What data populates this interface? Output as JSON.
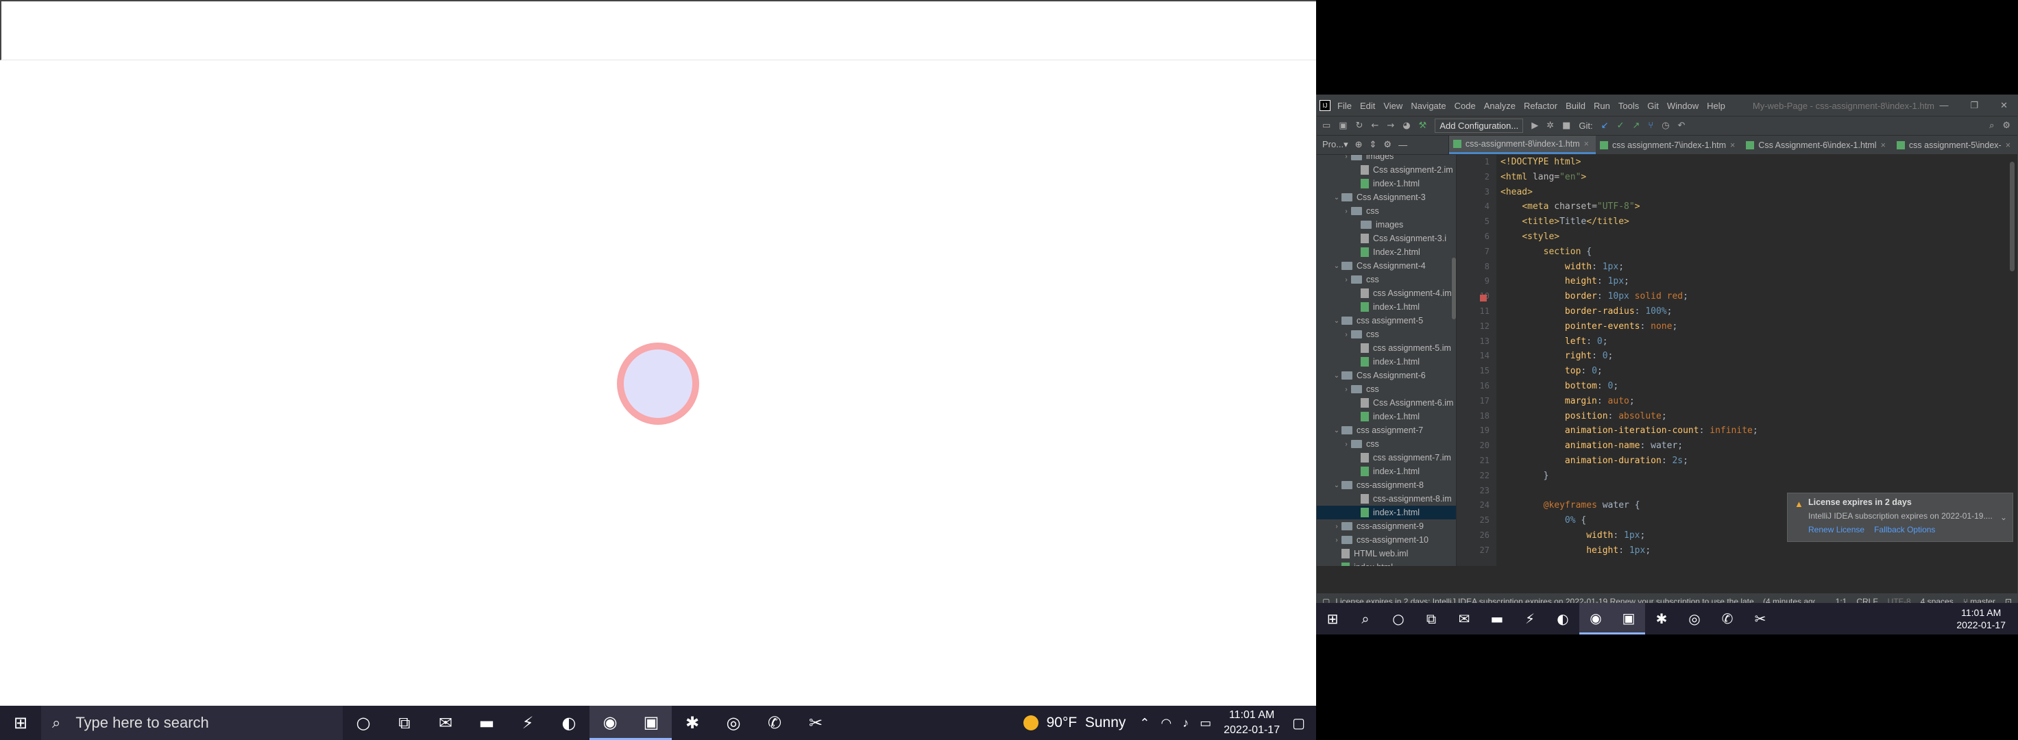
{
  "left": {
    "taskbar": {
      "start": "⊞",
      "search_placeholder": "Type here to search",
      "search_icon": "search-icon",
      "apps": [
        {
          "name": "cortana-icon",
          "glyph": "○",
          "active": false
        },
        {
          "name": "task-view-icon",
          "glyph": "⧉",
          "active": false
        },
        {
          "name": "mail-icon",
          "glyph": "✉",
          "active": false
        },
        {
          "name": "file-explorer-icon",
          "glyph": "▬",
          "active": false
        },
        {
          "name": "bolt-app-icon",
          "glyph": "⚡",
          "active": false
        },
        {
          "name": "edge-icon",
          "glyph": "◐",
          "active": false
        },
        {
          "name": "chrome-icon",
          "glyph": "◉",
          "active": true
        },
        {
          "name": "intellij-icon",
          "glyph": "▣",
          "active": true
        },
        {
          "name": "slack-icon",
          "glyph": "✱",
          "active": false
        },
        {
          "name": "recorder-icon",
          "glyph": "◎",
          "active": false
        },
        {
          "name": "whatsapp-icon",
          "glyph": "✆",
          "active": false
        },
        {
          "name": "snipping-icon",
          "glyph": "✂",
          "active": false
        }
      ],
      "weather": {
        "temp": "90°F",
        "cond": "Sunny"
      },
      "tray_glyphs": {
        "chevron": "⌃",
        "wifi": "◠",
        "volume": "♪",
        "battery": "▭"
      },
      "time": "11:01 AM",
      "date": "2022-01-17",
      "notifications_glyph": "▢"
    }
  },
  "ide": {
    "menu": [
      "File",
      "Edit",
      "View",
      "Navigate",
      "Code",
      "Analyze",
      "Refactor",
      "Build",
      "Run",
      "Tools",
      "Git",
      "Window",
      "Help"
    ],
    "window_title": "My-web-Page - css-assignment-8\\index-1.htm",
    "window_controls": {
      "minimize": "—",
      "restore": "❐",
      "close": "✕"
    },
    "toolbar": {
      "add_config": "Add Configuration...",
      "git_label": "Git:"
    },
    "project_label": "Pro...▾",
    "tabs": [
      {
        "label": "css-assignment-8\\index-1.htm",
        "active": true
      },
      {
        "label": "css assignment-7\\index-1.htm",
        "active": false
      },
      {
        "label": "Css Assignment-6\\index-1.html",
        "active": false
      },
      {
        "label": "css assignment-5\\index-",
        "active": false
      }
    ],
    "tree": [
      {
        "indent": 2,
        "type": "folder",
        "arrow": "›",
        "label": "images"
      },
      {
        "indent": 3,
        "type": "iml",
        "arrow": "",
        "label": "Css assignment-2.im"
      },
      {
        "indent": 3,
        "type": "file",
        "arrow": "",
        "label": "index-1.html"
      },
      {
        "indent": 1,
        "type": "folder",
        "arrow": "⌄",
        "label": "Css Assignment-3"
      },
      {
        "indent": 2,
        "type": "folder",
        "arrow": "›",
        "label": "css"
      },
      {
        "indent": 3,
        "type": "folder",
        "arrow": "",
        "label": "images"
      },
      {
        "indent": 3,
        "type": "iml",
        "arrow": "",
        "label": "Css Assignment-3.i"
      },
      {
        "indent": 3,
        "type": "file",
        "arrow": "",
        "label": "Index-2.html"
      },
      {
        "indent": 1,
        "type": "folder",
        "arrow": "⌄",
        "label": "Css Assignment-4"
      },
      {
        "indent": 2,
        "type": "folder",
        "arrow": "›",
        "label": "css"
      },
      {
        "indent": 3,
        "type": "iml",
        "arrow": "",
        "label": "css Assignment-4.im"
      },
      {
        "indent": 3,
        "type": "file",
        "arrow": "",
        "label": "index-1.html"
      },
      {
        "indent": 1,
        "type": "folder",
        "arrow": "⌄",
        "label": "css assignment-5"
      },
      {
        "indent": 2,
        "type": "folder",
        "arrow": "›",
        "label": "css"
      },
      {
        "indent": 3,
        "type": "iml",
        "arrow": "",
        "label": "css assignment-5.im"
      },
      {
        "indent": 3,
        "type": "file",
        "arrow": "",
        "label": "index-1.html"
      },
      {
        "indent": 1,
        "type": "folder",
        "arrow": "⌄",
        "label": "Css Assignment-6"
      },
      {
        "indent": 2,
        "type": "folder",
        "arrow": "›",
        "label": "css"
      },
      {
        "indent": 3,
        "type": "iml",
        "arrow": "",
        "label": "Css Assignment-6.im"
      },
      {
        "indent": 3,
        "type": "file",
        "arrow": "",
        "label": "index-1.html"
      },
      {
        "indent": 1,
        "type": "folder",
        "arrow": "⌄",
        "label": "css assignment-7"
      },
      {
        "indent": 2,
        "type": "folder",
        "arrow": "›",
        "label": "css"
      },
      {
        "indent": 3,
        "type": "iml",
        "arrow": "",
        "label": "css assignment-7.im"
      },
      {
        "indent": 3,
        "type": "file",
        "arrow": "",
        "label": "index-1.html"
      },
      {
        "indent": 1,
        "type": "folder",
        "arrow": "⌄",
        "label": "css-assignment-8"
      },
      {
        "indent": 3,
        "type": "iml",
        "arrow": "",
        "label": "css-assignment-8.im"
      },
      {
        "indent": 3,
        "type": "file",
        "arrow": "",
        "label": "index-1.html",
        "selected": true
      },
      {
        "indent": 1,
        "type": "folder",
        "arrow": "›",
        "label": "css-assignment-9"
      },
      {
        "indent": 1,
        "type": "folder",
        "arrow": "›",
        "label": "css-assignment-10"
      },
      {
        "indent": 1,
        "type": "iml",
        "arrow": "",
        "label": "HTML web.iml"
      },
      {
        "indent": 1,
        "type": "file",
        "arrow": "",
        "label": "index.html"
      }
    ],
    "code": [
      [
        {
          "c": "tag",
          "t": "<!DOCTYPE html>"
        }
      ],
      [
        {
          "c": "tag",
          "t": "<html "
        },
        {
          "c": "attr",
          "t": "lang="
        },
        {
          "c": "str",
          "t": "\"en\""
        },
        {
          "c": "tag",
          "t": ">"
        }
      ],
      [
        {
          "c": "tag",
          "t": "<head>"
        }
      ],
      [
        {
          "c": "",
          "t": "    "
        },
        {
          "c": "tag",
          "t": "<meta "
        },
        {
          "c": "attr",
          "t": "charset="
        },
        {
          "c": "str",
          "t": "\"UTF-8\""
        },
        {
          "c": "tag",
          "t": ">"
        }
      ],
      [
        {
          "c": "",
          "t": "    "
        },
        {
          "c": "tag",
          "t": "<title>"
        },
        {
          "c": "",
          "t": "Title"
        },
        {
          "c": "tag",
          "t": "</title>"
        }
      ],
      [
        {
          "c": "",
          "t": "    "
        },
        {
          "c": "tag",
          "t": "<style>"
        }
      ],
      [
        {
          "c": "",
          "t": "        "
        },
        {
          "c": "sel",
          "t": "section"
        },
        {
          "c": "",
          "t": " {"
        }
      ],
      [
        {
          "c": "",
          "t": "            "
        },
        {
          "c": "prop",
          "t": "width"
        },
        {
          "c": "",
          "t": ": "
        },
        {
          "c": "num",
          "t": "1px"
        },
        {
          "c": "",
          "t": ";"
        }
      ],
      [
        {
          "c": "",
          "t": "            "
        },
        {
          "c": "prop",
          "t": "height"
        },
        {
          "c": "",
          "t": ": "
        },
        {
          "c": "num",
          "t": "1px"
        },
        {
          "c": "",
          "t": ";"
        }
      ],
      [
        {
          "c": "",
          "t": "            "
        },
        {
          "c": "prop",
          "t": "border"
        },
        {
          "c": "",
          "t": ": "
        },
        {
          "c": "num",
          "t": "10px"
        },
        {
          "c": "kw",
          "t": " solid red"
        },
        {
          "c": "",
          "t": ";"
        }
      ],
      [
        {
          "c": "",
          "t": "            "
        },
        {
          "c": "prop",
          "t": "border-radius"
        },
        {
          "c": "",
          "t": ": "
        },
        {
          "c": "num",
          "t": "100%"
        },
        {
          "c": "",
          "t": ";"
        }
      ],
      [
        {
          "c": "",
          "t": "            "
        },
        {
          "c": "prop",
          "t": "pointer-events"
        },
        {
          "c": "",
          "t": ": "
        },
        {
          "c": "kw",
          "t": "none"
        },
        {
          "c": "",
          "t": ";"
        }
      ],
      [
        {
          "c": "",
          "t": "            "
        },
        {
          "c": "prop",
          "t": "left"
        },
        {
          "c": "",
          "t": ": "
        },
        {
          "c": "num",
          "t": "0"
        },
        {
          "c": "",
          "t": ";"
        }
      ],
      [
        {
          "c": "",
          "t": "            "
        },
        {
          "c": "prop",
          "t": "right"
        },
        {
          "c": "",
          "t": ": "
        },
        {
          "c": "num",
          "t": "0"
        },
        {
          "c": "",
          "t": ";"
        }
      ],
      [
        {
          "c": "",
          "t": "            "
        },
        {
          "c": "prop",
          "t": "top"
        },
        {
          "c": "",
          "t": ": "
        },
        {
          "c": "num",
          "t": "0"
        },
        {
          "c": "",
          "t": ";"
        }
      ],
      [
        {
          "c": "",
          "t": "            "
        },
        {
          "c": "prop",
          "t": "bottom"
        },
        {
          "c": "",
          "t": ": "
        },
        {
          "c": "num",
          "t": "0"
        },
        {
          "c": "",
          "t": ";"
        }
      ],
      [
        {
          "c": "",
          "t": "            "
        },
        {
          "c": "prop",
          "t": "margin"
        },
        {
          "c": "",
          "t": ": "
        },
        {
          "c": "kw",
          "t": "auto"
        },
        {
          "c": "",
          "t": ";"
        }
      ],
      [
        {
          "c": "",
          "t": "            "
        },
        {
          "c": "prop",
          "t": "position"
        },
        {
          "c": "",
          "t": ": "
        },
        {
          "c": "kw",
          "t": "absolute"
        },
        {
          "c": "",
          "t": ";"
        }
      ],
      [
        {
          "c": "",
          "t": "            "
        },
        {
          "c": "prop",
          "t": "animation-iteration-count"
        },
        {
          "c": "",
          "t": ": "
        },
        {
          "c": "kw",
          "t": "infinite"
        },
        {
          "c": "",
          "t": ";"
        }
      ],
      [
        {
          "c": "",
          "t": "            "
        },
        {
          "c": "prop",
          "t": "animation-name"
        },
        {
          "c": "",
          "t": ": "
        },
        {
          "c": "",
          "t": "water"
        },
        {
          "c": "",
          "t": ";"
        }
      ],
      [
        {
          "c": "",
          "t": "            "
        },
        {
          "c": "prop",
          "t": "animation-duration"
        },
        {
          "c": "",
          "t": ": "
        },
        {
          "c": "num",
          "t": "2s"
        },
        {
          "c": "",
          "t": ";"
        }
      ],
      [
        {
          "c": "",
          "t": "        }"
        }
      ],
      [
        {
          "c": "",
          "t": ""
        }
      ],
      [
        {
          "c": "",
          "t": "        "
        },
        {
          "c": "kw",
          "t": "@keyframes"
        },
        {
          "c": "",
          "t": " water {"
        }
      ],
      [
        {
          "c": "",
          "t": "            "
        },
        {
          "c": "num",
          "t": "0%"
        },
        {
          "c": "",
          "t": " {"
        }
      ],
      [
        {
          "c": "",
          "t": "                "
        },
        {
          "c": "prop",
          "t": "width"
        },
        {
          "c": "",
          "t": ": "
        },
        {
          "c": "num",
          "t": "1px"
        },
        {
          "c": "",
          "t": ";"
        }
      ],
      [
        {
          "c": "",
          "t": "                "
        },
        {
          "c": "prop",
          "t": "height"
        },
        {
          "c": "",
          "t": ": "
        },
        {
          "c": "num",
          "t": "1px"
        },
        {
          "c": "",
          "t": ";"
        }
      ]
    ],
    "notification": {
      "title": "License expires in 2 days",
      "body": "IntelliJ IDEA subscription expires on 2022-01-19....",
      "link1": "Renew License",
      "link2": "Fallback Options"
    },
    "status": {
      "message": "License expires in 2 days: IntelliJ IDEA subscription expires on 2022-01-19.Renew your subscription to use the late... (4 minutes ago)",
      "pos": "1:1",
      "eol": "CRLF",
      "enc": "UTF-8",
      "indent": "4 spaces",
      "branch": "master"
    }
  },
  "right": {
    "taskbar": {
      "start": "⊞",
      "apps": [
        {
          "name": "search-icon",
          "glyph": "⌕",
          "active": false
        },
        {
          "name": "cortana-icon",
          "glyph": "○",
          "active": false
        },
        {
          "name": "task-view-icon",
          "glyph": "⧉",
          "active": false
        },
        {
          "name": "mail-icon",
          "glyph": "✉",
          "active": false
        },
        {
          "name": "file-explorer-icon",
          "glyph": "▬",
          "active": false
        },
        {
          "name": "bolt-app-icon",
          "glyph": "⚡",
          "active": false
        },
        {
          "name": "edge-icon",
          "glyph": "◐",
          "active": false
        },
        {
          "name": "chrome-icon",
          "glyph": "◉",
          "active": true
        },
        {
          "name": "intellij-icon",
          "glyph": "▣",
          "active": true
        },
        {
          "name": "slack-icon",
          "glyph": "✱",
          "active": false
        },
        {
          "name": "recorder-icon",
          "glyph": "◎",
          "active": false
        },
        {
          "name": "whatsapp-icon",
          "glyph": "✆",
          "active": false
        },
        {
          "name": "snipping-icon",
          "glyph": "✂",
          "active": false
        }
      ],
      "time": "11:01 AM",
      "date": "2022-01-17"
    }
  }
}
